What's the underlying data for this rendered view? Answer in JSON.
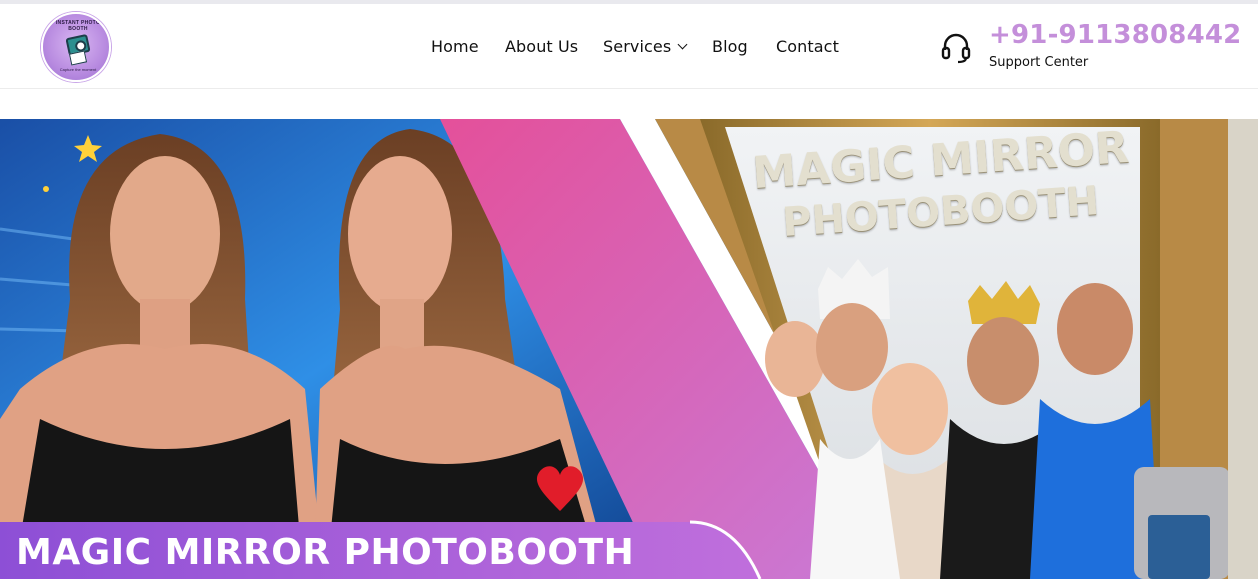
{
  "header": {
    "logo": {
      "top_text": "INSTANT PHOTO BOOTH",
      "bottom_text": "Capture the moment"
    },
    "nav": {
      "items": [
        {
          "label": "Home"
        },
        {
          "label": "About Us"
        },
        {
          "label": "Services"
        },
        {
          "label": "Blog"
        },
        {
          "label": "Contact"
        }
      ]
    },
    "support": {
      "phone": "+91-9113808442",
      "label": "Support Center",
      "icon": "headset-icon"
    }
  },
  "banner": {
    "title": "MAGIC MIRROR PHOTOBOOTH",
    "mirror_text_line1": "MAGIC MIRROR",
    "mirror_text_line2": "PHOTOBOOTH",
    "colors": {
      "left_bg": "#1b5fb8",
      "pink_stripe": "#e05aa0",
      "title_band": "#a657d6",
      "phone": "#c48fda"
    }
  }
}
